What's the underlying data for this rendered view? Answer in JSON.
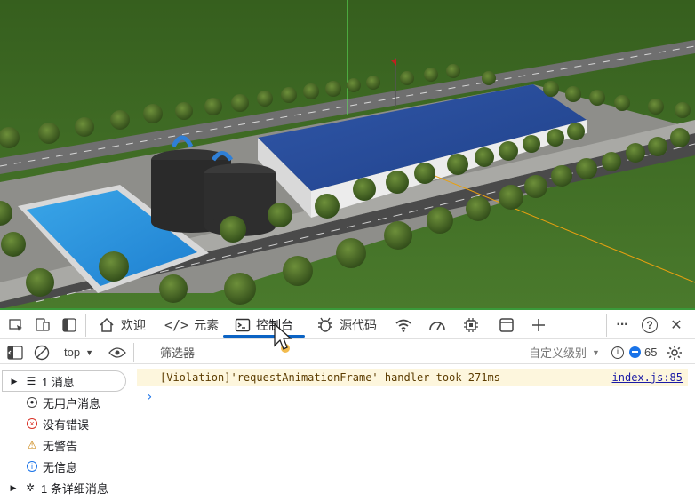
{
  "main_toolbar": {
    "tabs": [
      {
        "label": "欢迎",
        "icon": "home-icon"
      },
      {
        "label": "元素",
        "icon": "code-icon"
      },
      {
        "label": "控制台",
        "icon": "console-icon",
        "active": true
      },
      {
        "label": "源代码",
        "icon": "bug-icon"
      }
    ],
    "more_label": "···",
    "help_label": "?",
    "close_label": "✕"
  },
  "console_toolbar": {
    "context": "top",
    "filter_placeholder": "筛选器",
    "level": "自定义级别",
    "issues_count": "65"
  },
  "sidebar": {
    "items": [
      {
        "label": "1 消息",
        "icon": "list-icon",
        "expandable": true,
        "selected": true
      },
      {
        "label": "无用户消息",
        "icon": "user-icon"
      },
      {
        "label": "没有错误",
        "icon": "error-icon"
      },
      {
        "label": "无警告",
        "icon": "warning-icon"
      },
      {
        "label": "无信息",
        "icon": "info-icon"
      },
      {
        "label": "1 条详细消息",
        "icon": "verbose-icon",
        "expandable": true
      }
    ]
  },
  "console": {
    "messages": [
      {
        "level": "violation",
        "text": "[Violation]'requestAnimationFrame' handler took 271ms",
        "source": "index.js:85"
      }
    ],
    "prompt": "›"
  },
  "colors": {
    "accent": "#0b63c4",
    "warning_bg": "#fdf6dd",
    "link": "#1a1aa6",
    "scene_grass": "#3d6b25"
  }
}
